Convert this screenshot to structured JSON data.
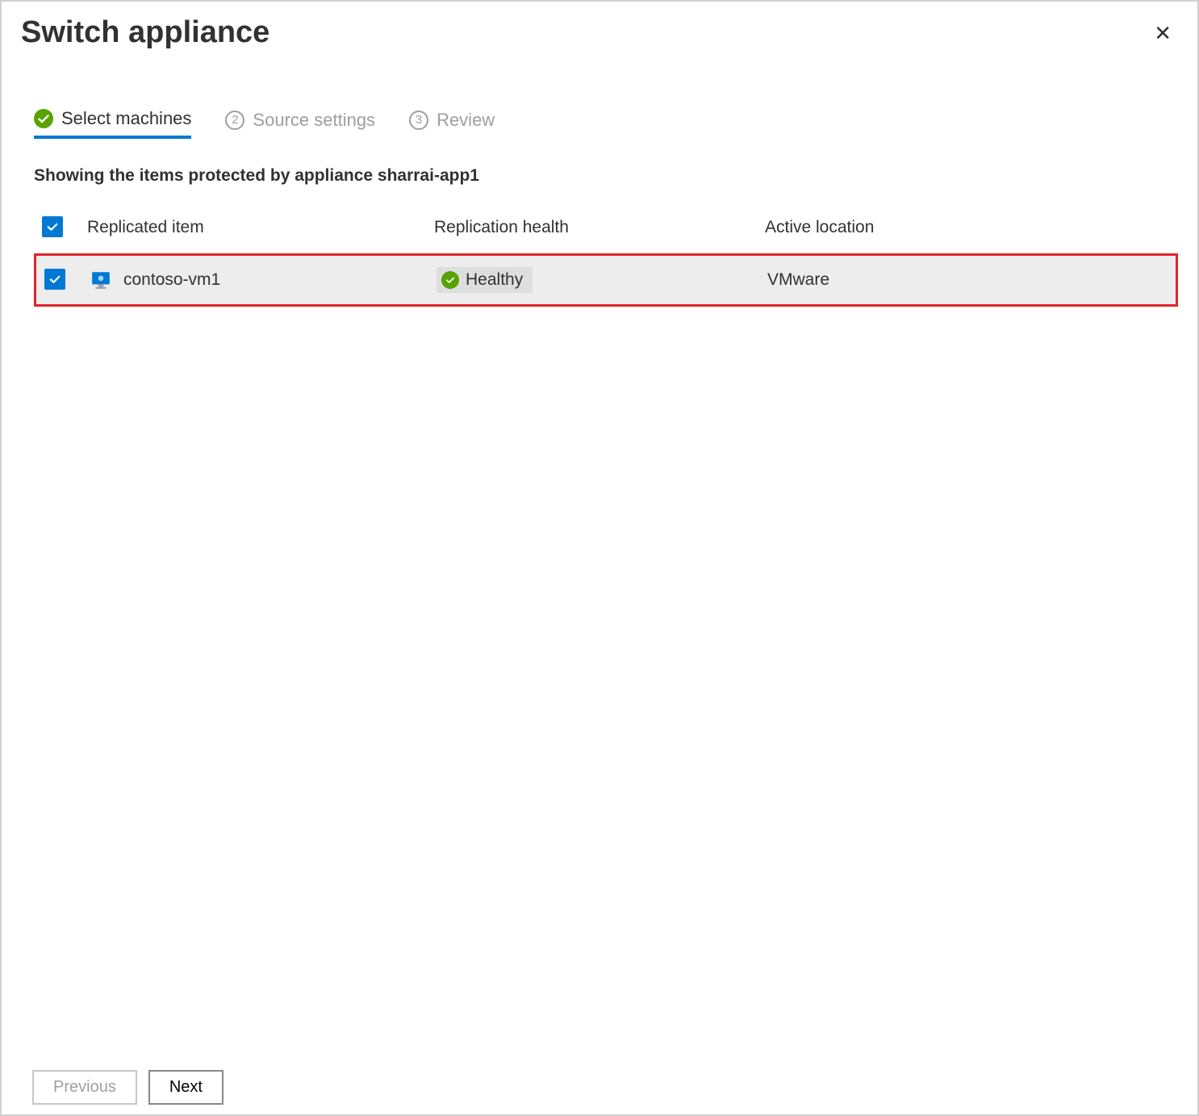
{
  "header": {
    "title": "Switch appliance",
    "close_label": "✕"
  },
  "steps": {
    "s1": {
      "label": "Select machines"
    },
    "s2": {
      "num": "2",
      "label": "Source settings"
    },
    "s3": {
      "num": "3",
      "label": "Review"
    }
  },
  "subheading": "Showing the items protected by appliance sharrai-app1",
  "columns": {
    "replicated_item": "Replicated item",
    "replication_health": "Replication health",
    "active_location": "Active location"
  },
  "rows": [
    {
      "checked": true,
      "name": "contoso-vm1",
      "health_label": "Healthy",
      "location": "VMware"
    }
  ],
  "footer": {
    "previous": "Previous",
    "next": "Next"
  },
  "colors": {
    "accent": "#0078d4",
    "success": "#57a300",
    "highlight": "#e1242a"
  }
}
